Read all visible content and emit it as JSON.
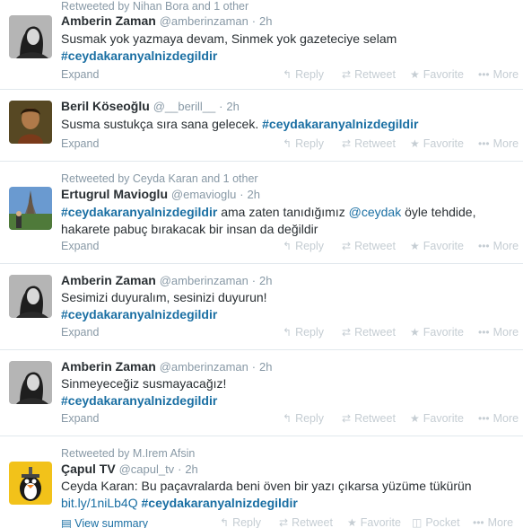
{
  "tweets": [
    {
      "retweeted_by": "Retweeted by Nihan Bora and 1 other",
      "name": "Amberin Zaman",
      "handle": "@amberinzaman",
      "time": "2h",
      "line1": "Susmak yok yazmaya devam, Sinmek yok gazeteciye selam",
      "hashtag": "#ceydakaranyalnizdegildir",
      "expand": "Expand",
      "avatar": "profile-photo-woman"
    },
    {
      "name": "Beril Köseoğlu",
      "handle": "@__berill__",
      "time": "2h",
      "text": "Susma sustukça sıra sana gelecek.",
      "hashtag": "#ceydakaranyalnizdegildir",
      "expand": "Expand",
      "avatar": "profile-photo-portrait"
    },
    {
      "retweeted_by": "Retweeted by Ceyda Karan and 1 other",
      "name": "Ertugrul Mavioglu",
      "handle": "@emavioglu",
      "time": "2h",
      "hashtag": "#ceydakaranyalnizdegildir",
      "text_a": "ama zaten tanıdığımız",
      "mention": "@ceydak",
      "text_b": "öyle tehdide,",
      "line2": "hakarete pabuç bırakacak bir insan da değildir",
      "expand": "Expand",
      "avatar": "profile-photo-eiffel"
    },
    {
      "name": "Amberin Zaman",
      "handle": "@amberinzaman",
      "time": "2h",
      "line1": "Sesimizi duyuralım, sesinizi duyurun!",
      "hashtag": "#ceydakaranyalnizdegildir",
      "expand": "Expand",
      "avatar": "profile-photo-woman"
    },
    {
      "name": "Amberin Zaman",
      "handle": "@amberinzaman",
      "time": "2h",
      "line1": "Sinmeyeceğiz susmayacağız!",
      "hashtag": "#ceydakaranyalnizdegildir",
      "expand": "Expand",
      "avatar": "profile-photo-woman"
    },
    {
      "retweeted_by": "Retweeted by M.Irem Afsin",
      "name": "Çapul TV",
      "handle": "@capul_tv",
      "time": "2h",
      "line1": "Ceyda Karan: Bu paçavralarda beni öven bir yazı çıkarsa yüzüme tükürün",
      "link": "bit.ly/1niLb4Q",
      "hashtag": "#ceydakaranyalnizdegildir",
      "summary": "View summary",
      "avatar": "penguin-logo"
    }
  ],
  "actions": {
    "reply": "Reply",
    "retweet": "Retweet",
    "favorite": "Favorite",
    "more": "More",
    "pocket": "Pocket"
  },
  "icons": {
    "reply": "reply-icon",
    "retweet": "retweet-icon",
    "favorite": "star-icon",
    "more": "more-icon",
    "pocket": "pocket-icon",
    "summary": "summary-icon"
  },
  "colors": {
    "link": "#1a6fa3",
    "muted": "#8899a6",
    "text": "#292f33",
    "action": "#c5cdd3"
  },
  "dot": "·"
}
